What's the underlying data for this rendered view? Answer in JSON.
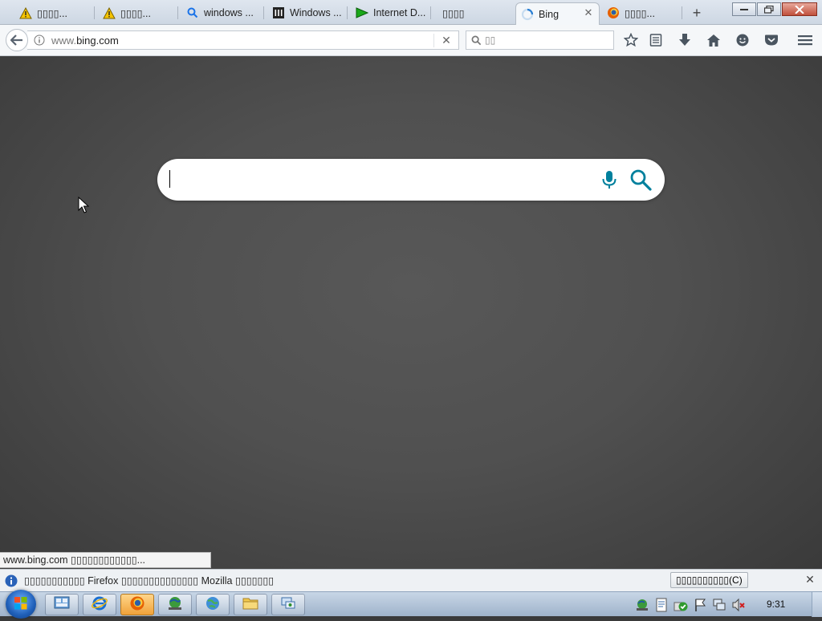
{
  "tabs": [
    {
      "icon": "warning-icon",
      "title": "▯▯▯▯..."
    },
    {
      "icon": "warning-icon",
      "title": "▯▯▯▯..."
    },
    {
      "icon": "search-icon",
      "title": "windows ..."
    },
    {
      "icon": "site-columns-icon",
      "title": "Windows ..."
    },
    {
      "icon": "play-triangle-icon",
      "title": "Internet D..."
    },
    {
      "icon": "",
      "title": "▯▯▯▯"
    },
    {
      "icon": "loading-spinner-icon",
      "title": "Bing",
      "active": true
    },
    {
      "icon": "firefox-icon",
      "title": "▯▯▯▯..."
    }
  ],
  "navbar": {
    "url_prefix": "www.",
    "url_domain": "bing.com",
    "search_placeholder": "▯▯"
  },
  "bing": {
    "search_value": ""
  },
  "status_link": "www.bing.com ▯▯▯▯▯▯▯▯▯▯▯▯...",
  "notification": {
    "text": "▯▯▯▯▯▯▯▯▯▯▯ Firefox ▯▯▯▯▯▯▯▯▯▯▯▯▯▯ Mozilla ▯▯▯▯▯▯▯",
    "button_label": "▯▯▯▯▯▯▯▯▯▯(C)"
  },
  "taskbar": {
    "buttons": [
      {
        "icon": "control-panel-icon"
      },
      {
        "icon": "internet-explorer-icon"
      },
      {
        "icon": "firefox-icon",
        "active": true
      },
      {
        "icon": "network-globe-icon"
      },
      {
        "icon": "internet-globe-icon"
      },
      {
        "icon": "file-explorer-icon"
      },
      {
        "icon": "remote-desktop-icon"
      }
    ],
    "clock": "9:31"
  },
  "colors": {
    "bing_accent": "#00809d",
    "page_background": "#505050"
  }
}
